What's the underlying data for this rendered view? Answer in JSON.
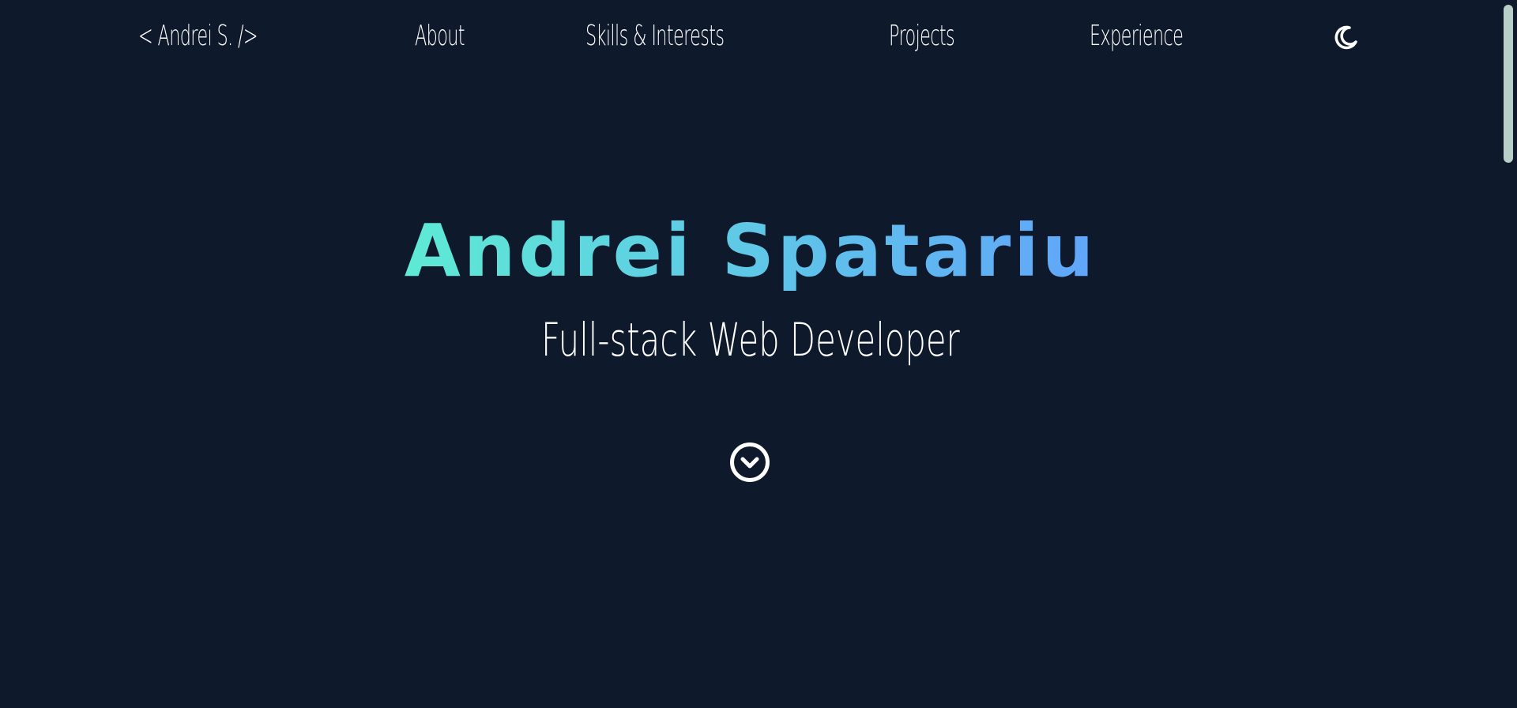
{
  "nav": {
    "logo": "< Andrei S. />",
    "about": "About",
    "skills": "Skills & Interests",
    "projects": "Projects",
    "experience": "Experience",
    "theme_icon": "moon-icon"
  },
  "hero": {
    "name": "Andrei Spatariu",
    "subtitle": "Full-stack Web Developer",
    "scroll_icon": "chevron-down-circle-icon"
  },
  "colors": {
    "background": "#0f192c",
    "gradient_start": "#5eead4",
    "gradient_end": "#60a5fa",
    "text": "#ffffff",
    "scrollbar_thumb": "#b7cfc6"
  }
}
